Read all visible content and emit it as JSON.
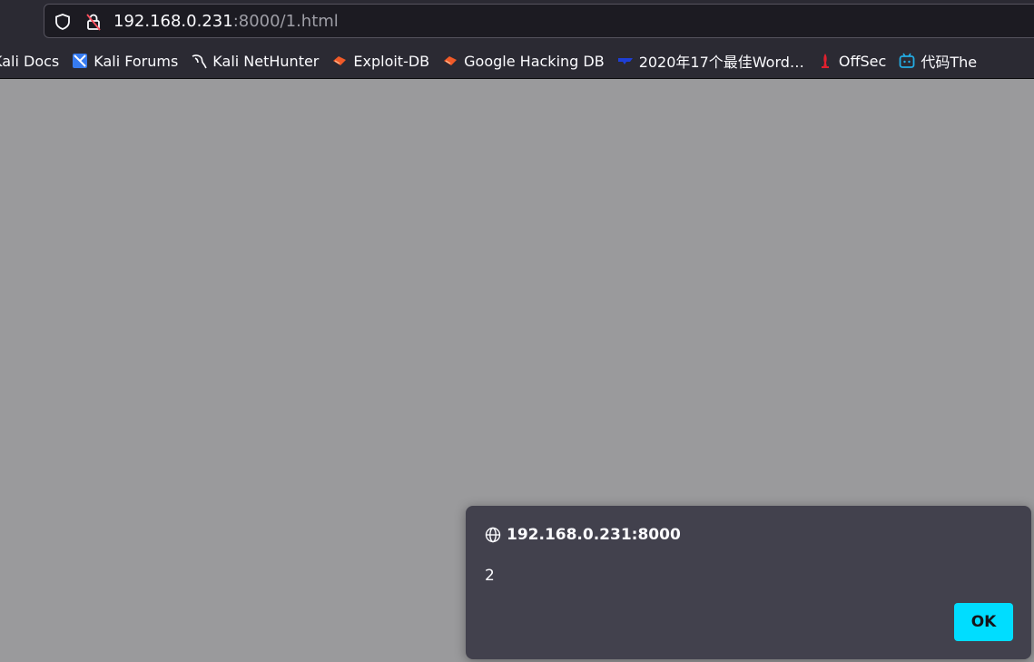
{
  "urlbar": {
    "host": "192.168.0.231",
    "rest": ":8000/1.html",
    "shield_icon": "tracking-protection-shield-icon",
    "lock_icon": "insecure-lock-icon"
  },
  "bookmarks": [
    {
      "label": "Kali Docs",
      "icon": "kali-docs-icon"
    },
    {
      "label": "Kali Forums",
      "icon": "kali-forums-icon"
    },
    {
      "label": "Kali NetHunter",
      "icon": "kali-dragon-icon"
    },
    {
      "label": "Exploit-DB",
      "icon": "exploit-db-icon"
    },
    {
      "label": "Google Hacking DB",
      "icon": "exploit-db-icon"
    },
    {
      "label": "2020年17个最佳Word…",
      "icon": "blue-wave-icon"
    },
    {
      "label": "OffSec",
      "icon": "offsec-icon"
    },
    {
      "label": "代码The",
      "icon": "bilibili-icon"
    }
  ],
  "dialog": {
    "origin": "192.168.0.231:8000",
    "message": "2",
    "ok_label": "OK"
  },
  "colors": {
    "page_bg": "#9a9a9c",
    "toolbar_bg": "#2b2a33",
    "dialog_bg": "#42414d",
    "accent": "#00ddff"
  }
}
